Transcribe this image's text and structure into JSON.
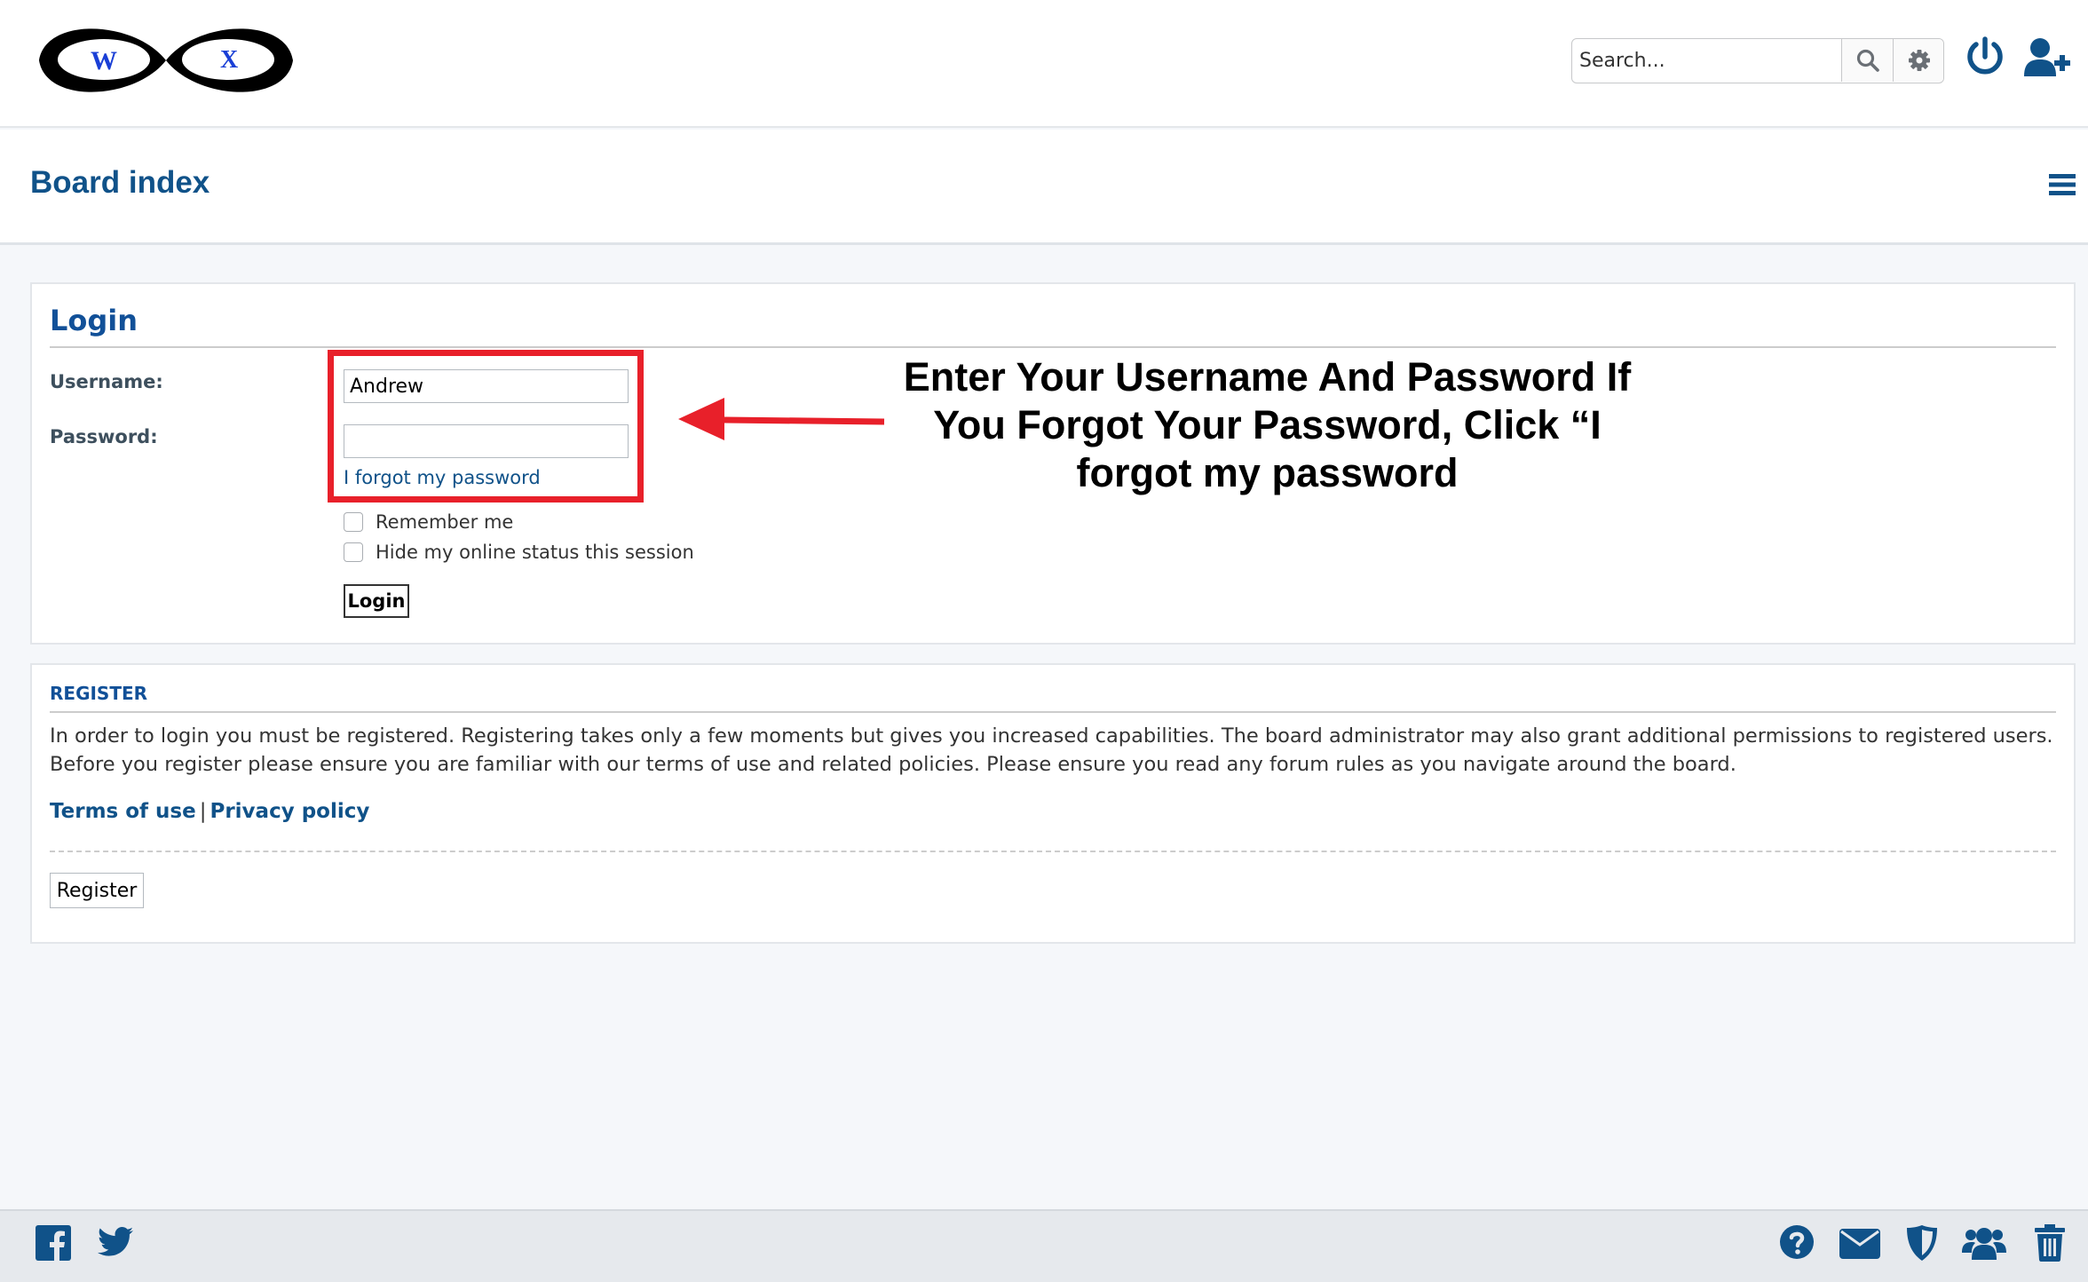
{
  "header": {
    "logo_letters": [
      "W",
      "X"
    ],
    "search": {
      "placeholder": "Search...",
      "value": ""
    },
    "icons": [
      "search-icon",
      "gear-icon",
      "power-icon",
      "user-plus-icon"
    ]
  },
  "nav": {
    "board_index": "Board index",
    "menu_icon": "hamburger-icon"
  },
  "login": {
    "heading": "Login",
    "username_label": "Username:",
    "username_value": "Andrew",
    "password_label": "Password:",
    "password_value": "",
    "forgot_link": "I forgot my password",
    "remember_label": "Remember me",
    "hide_status_label": "Hide my online status this session",
    "login_button": "Login"
  },
  "annotation": {
    "text": "Enter Your Username And Password If You Forgot Your Password, Click “I forgot my password",
    "accent": "#e8202a"
  },
  "register": {
    "heading": "REGISTER",
    "text": "In order to login you must be registered. Registering takes only a few moments but gives you increased capabilities. The board administrator may also grant additional permissions to registered users. Before you register please ensure you are familiar with our terms of use and related policies. Please ensure you read any forum rules as you navigate around the board.",
    "terms_link": "Terms of use",
    "separator": "|",
    "privacy_link": "Privacy policy",
    "register_button": "Register"
  },
  "footer": {
    "left_icons": [
      "facebook-icon",
      "twitter-icon"
    ],
    "right_icons": [
      "help-icon",
      "envelope-icon",
      "shield-icon",
      "users-icon",
      "trash-icon"
    ]
  },
  "colors": {
    "link": "#105289",
    "heading": "#115098",
    "background": "#f5f7fa"
  }
}
